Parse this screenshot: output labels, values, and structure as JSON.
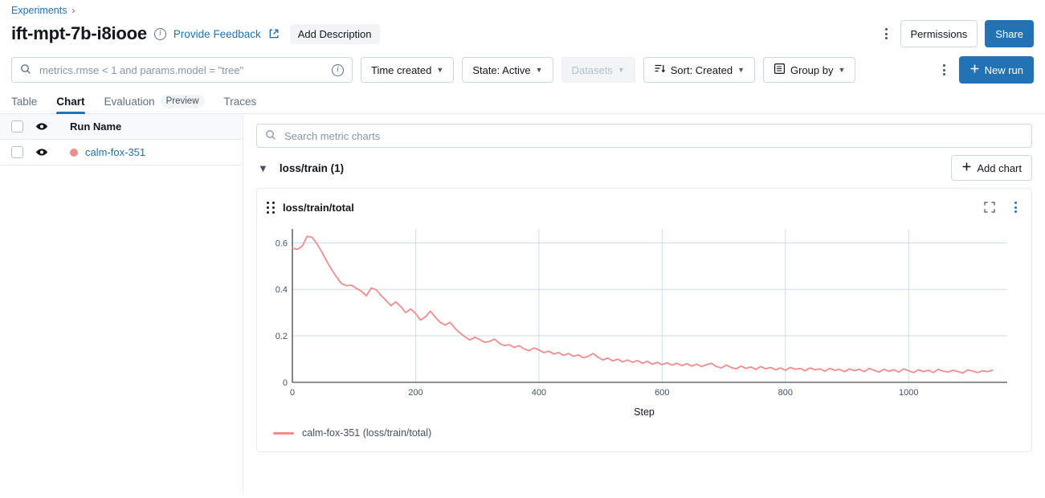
{
  "breadcrumb": {
    "items": [
      "Experiments"
    ],
    "separator": "›"
  },
  "header": {
    "title": "ift-mpt-7b-i8iooe",
    "info_icon": "info-icon",
    "feedback_label": "Provide Feedback",
    "external_link_icon": "external-link-icon",
    "add_description_label": "Add Description",
    "overflow_icon": "kebab-menu-icon",
    "permissions_label": "Permissions",
    "share_label": "Share"
  },
  "toolbar": {
    "search_value": "",
    "search_placeholder": "metrics.rmse < 1 and params.model = \"tree\"",
    "search_icon": "search-icon",
    "search_info_icon": "info-icon",
    "time_created_label": "Time created",
    "state_label": "State: Active",
    "datasets_label": "Datasets",
    "sort_label": "Sort: Created",
    "sort_icon": "sort-descending-icon",
    "group_by_label": "Group by",
    "group_by_icon": "list-box-icon",
    "overflow_icon": "kebab-menu-icon",
    "new_run_label": "New run",
    "new_run_icon": "plus-icon"
  },
  "tabs": [
    {
      "label": "Table",
      "active": false
    },
    {
      "label": "Chart",
      "active": true
    },
    {
      "label": "Evaluation",
      "badge": "Preview",
      "active": false
    },
    {
      "label": "Traces",
      "active": false
    }
  ],
  "runs_panel": {
    "column_header": "Run Name",
    "header_checkbox_name": "select-all-checkbox",
    "header_eye_icon": "eye-icon",
    "rows": [
      {
        "name": "calm-fox-351",
        "color": "#f08c8c",
        "eye_icon": "eye-icon"
      }
    ]
  },
  "charts_panel": {
    "metric_search_value": "",
    "metric_search_placeholder": "Search metric charts",
    "metric_search_icon": "search-icon",
    "section_label": "loss/train (1)",
    "section_chevron_icon": "chevron-down-icon",
    "add_chart_label": "Add chart",
    "add_chart_icon": "plus-icon",
    "card": {
      "drag_icon": "drag-handle-icon",
      "title": "loss/train/total",
      "expand_icon": "fullscreen-icon",
      "menu_icon": "kebab-menu-icon",
      "legend_label": "calm-fox-351 (loss/train/total)"
    }
  },
  "colors": {
    "accent_blue": "#2272b4",
    "series_pink": "#f08c8c",
    "grid": "#cddce8",
    "text_muted": "#5f7281"
  },
  "chart_data": {
    "type": "line",
    "title": "loss/train/total",
    "xlabel": "Step",
    "ylabel": "",
    "xlim": [
      0,
      1160
    ],
    "ylim": [
      0,
      0.66
    ],
    "xticks": [
      0,
      200,
      400,
      600,
      800,
      1000
    ],
    "ytick_labels": [
      "0",
      "0.2",
      "0.4",
      "0.6"
    ],
    "yticks": [
      0,
      0.2,
      0.4,
      0.6
    ],
    "grid": true,
    "legend_position": "bottom-left",
    "series": [
      {
        "name": "calm-fox-351 (loss/train/total)",
        "color": "#f08c8c",
        "x": [
          0,
          8,
          16,
          24,
          32,
          40,
          48,
          56,
          64,
          72,
          80,
          88,
          96,
          104,
          112,
          120,
          128,
          136,
          144,
          152,
          160,
          168,
          176,
          184,
          192,
          200,
          208,
          216,
          224,
          232,
          240,
          248,
          256,
          264,
          272,
          280,
          288,
          296,
          304,
          312,
          320,
          328,
          336,
          344,
          352,
          360,
          368,
          376,
          384,
          392,
          400,
          408,
          416,
          424,
          432,
          440,
          448,
          456,
          464,
          472,
          480,
          488,
          496,
          504,
          512,
          520,
          528,
          536,
          544,
          552,
          560,
          568,
          576,
          584,
          592,
          600,
          608,
          616,
          624,
          632,
          640,
          648,
          656,
          664,
          672,
          680,
          688,
          696,
          704,
          712,
          720,
          728,
          736,
          744,
          752,
          760,
          768,
          776,
          784,
          792,
          800,
          808,
          816,
          824,
          832,
          840,
          848,
          856,
          864,
          872,
          880,
          888,
          896,
          904,
          912,
          920,
          928,
          936,
          944,
          952,
          960,
          968,
          976,
          984,
          992,
          1000,
          1008,
          1016,
          1024,
          1032,
          1040,
          1048,
          1056,
          1064,
          1072,
          1080,
          1088,
          1096,
          1104,
          1112,
          1120,
          1128,
          1136,
          1144,
          1152,
          1160
        ],
        "y": [
          0.578,
          0.572,
          0.586,
          0.628,
          0.624,
          0.596,
          0.56,
          0.52,
          0.484,
          0.452,
          0.424,
          0.416,
          0.418,
          0.404,
          0.392,
          0.372,
          0.406,
          0.398,
          0.374,
          0.352,
          0.33,
          0.346,
          0.326,
          0.3,
          0.316,
          0.296,
          0.268,
          0.282,
          0.306,
          0.28,
          0.258,
          0.246,
          0.258,
          0.232,
          0.212,
          0.196,
          0.182,
          0.194,
          0.184,
          0.172,
          0.176,
          0.186,
          0.168,
          0.158,
          0.162,
          0.15,
          0.158,
          0.144,
          0.136,
          0.148,
          0.14,
          0.128,
          0.134,
          0.122,
          0.128,
          0.116,
          0.124,
          0.112,
          0.118,
          0.106,
          0.112,
          0.124,
          0.108,
          0.096,
          0.104,
          0.092,
          0.1,
          0.088,
          0.096,
          0.086,
          0.094,
          0.082,
          0.09,
          0.078,
          0.086,
          0.076,
          0.084,
          0.074,
          0.082,
          0.072,
          0.08,
          0.07,
          0.078,
          0.068,
          0.076,
          0.082,
          0.068,
          0.062,
          0.074,
          0.064,
          0.058,
          0.07,
          0.06,
          0.066,
          0.056,
          0.068,
          0.058,
          0.064,
          0.054,
          0.062,
          0.052,
          0.064,
          0.056,
          0.06,
          0.05,
          0.062,
          0.054,
          0.058,
          0.048,
          0.06,
          0.052,
          0.056,
          0.046,
          0.058,
          0.05,
          0.056,
          0.046,
          0.06,
          0.052,
          0.044,
          0.056,
          0.048,
          0.054,
          0.044,
          0.058,
          0.05,
          0.042,
          0.054,
          0.046,
          0.052,
          0.042,
          0.056,
          0.048,
          0.044,
          0.052,
          0.046,
          0.04,
          0.054,
          0.048,
          0.042,
          0.05,
          0.046,
          0.052
        ]
      }
    ]
  }
}
